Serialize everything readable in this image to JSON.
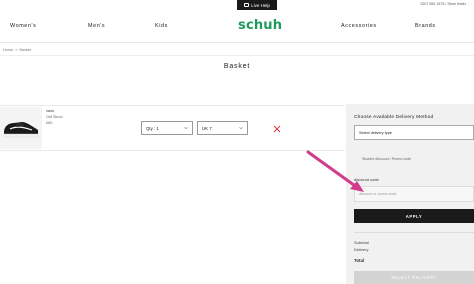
{
  "topbar": {
    "live_help": "Live Help",
    "phone_text": "0207 550 1575 / Store finder"
  },
  "nav": {
    "items": [
      "Women's",
      "Men's",
      "Kids",
      "Accessories",
      "Brands"
    ],
    "logo": "schuh"
  },
  "breadcrumb": {
    "home": "Home",
    "separator": ">",
    "current": "Basket"
  },
  "page": {
    "title": "Basket"
  },
  "line_item": {
    "brand": "vans",
    "name": "Old Skool",
    "price": "£60",
    "qty_value": "Qty : 1",
    "size_value": "UK 7"
  },
  "summary": {
    "delivery_title": "Choose Available Delivery Method",
    "delivery_select": "Select delivery type",
    "student_link": "Student discount / Promo code",
    "discount_label": "discount code",
    "discount_placeholder": "discount or promo code",
    "apply_label": "APPLY",
    "subtotal_label": "Subtotal",
    "delivery_label": "Delivery",
    "total_label": "Total",
    "select_delivery_label": "SELECT DELIVERY"
  },
  "colors": {
    "brand_green": "#1e9b5c",
    "accent_arrow": "#d23a8c",
    "panel_bg": "#f1f1f1"
  }
}
